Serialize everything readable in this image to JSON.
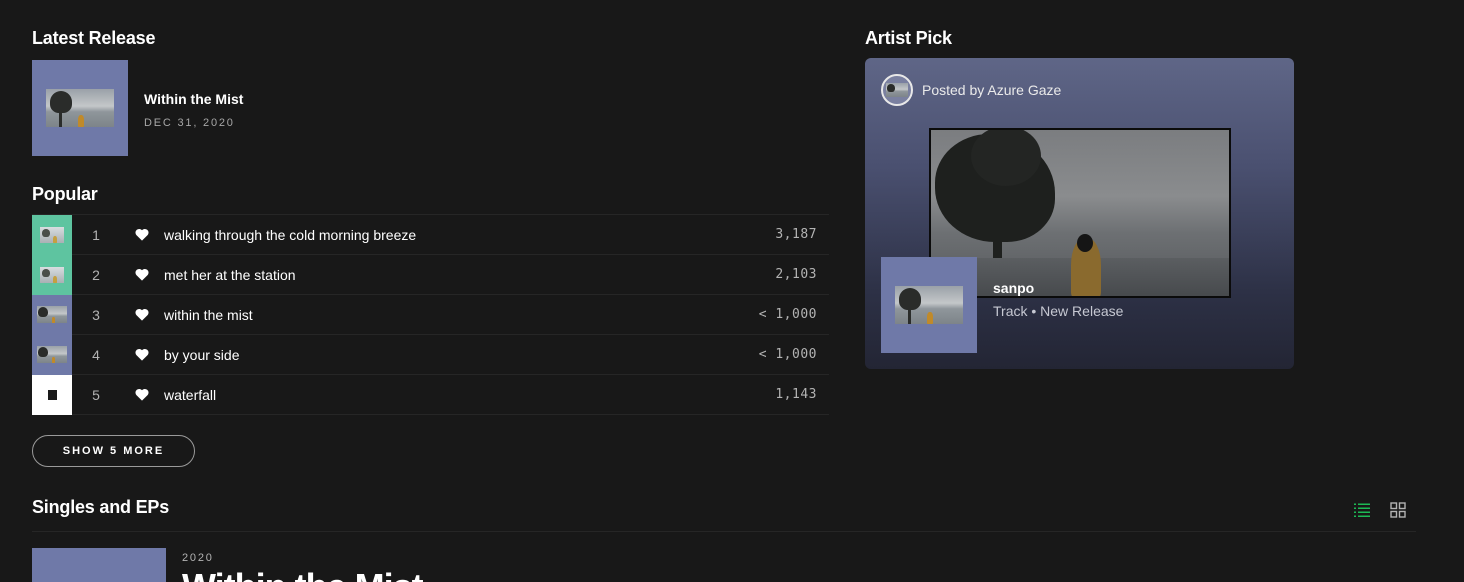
{
  "latest_release": {
    "heading": "Latest Release",
    "title": "Within the Mist",
    "date": "DEC 31, 2020"
  },
  "popular": {
    "heading": "Popular",
    "tracks": [
      {
        "rank": "1",
        "title": "walking through the cold morning breeze",
        "plays": "3,187",
        "cover_color": "#5ec4a0"
      },
      {
        "rank": "2",
        "title": "met her at the station",
        "plays": "2,103",
        "cover_color": "#5ec4a0"
      },
      {
        "rank": "3",
        "title": "within the mist",
        "plays": "< 1,000",
        "cover_color": "#6f79a8"
      },
      {
        "rank": "4",
        "title": "by your side",
        "plays": "< 1,000",
        "cover_color": "#6f79a8"
      },
      {
        "rank": "5",
        "title": "waterfall",
        "plays": "1,143",
        "cover_color": "#ffffff"
      }
    ],
    "show_more_label": "SHOW 5 MORE"
  },
  "artist_pick": {
    "heading": "Artist Pick",
    "posted_by": "Posted by Azure Gaze",
    "item_title": "sanpo",
    "item_subtitle": "Track • New Release"
  },
  "singles": {
    "heading": "Singles and EPs",
    "first_year": "2020",
    "first_title": "Within the Mist",
    "view_list_icon": "list-view-icon",
    "view_grid_icon": "grid-view-icon"
  },
  "colors": {
    "background": "#181818",
    "accent": "#1db954",
    "cover_blue": "#6f79a8",
    "cover_teal": "#5ec4a0"
  }
}
